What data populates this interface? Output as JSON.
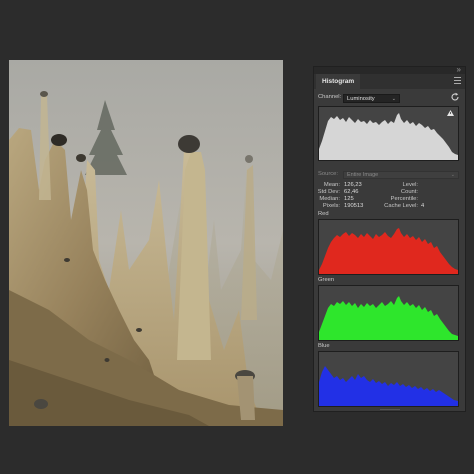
{
  "panel": {
    "tab_label": "Histogram",
    "channel_label": "Channel:",
    "channel_value": "Luminosity",
    "source_label": "Source:",
    "source_value": "Entire Image",
    "stats_left": [
      {
        "key": "Mean:",
        "value": "126,23"
      },
      {
        "key": "Std Dev:",
        "value": "62,46"
      },
      {
        "key": "Median:",
        "value": "125"
      },
      {
        "key": "Pixels:",
        "value": "190513"
      }
    ],
    "stats_right": [
      {
        "key": "Level:",
        "value": ""
      },
      {
        "key": "Count:",
        "value": ""
      },
      {
        "key": "Percentile:",
        "value": ""
      },
      {
        "key": "Cache Level:",
        "value": "4"
      }
    ],
    "channels": [
      {
        "name": "Red",
        "color": "#e0281e"
      },
      {
        "name": "Green",
        "color": "#2ee62c"
      },
      {
        "name": "Blue",
        "color": "#2230e6"
      }
    ],
    "luminosity_color": "#d6d6d6",
    "icons": [
      "collapse-icon",
      "panel-menu-icon",
      "refresh-icon",
      "warning-icon"
    ]
  }
}
